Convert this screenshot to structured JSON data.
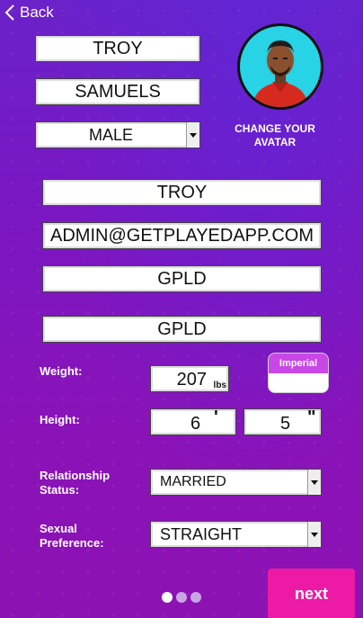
{
  "nav": {
    "back_label": "Back"
  },
  "profile": {
    "first_name": "TROY",
    "last_name": "SAMUELS",
    "gender": "MALE",
    "change_avatar_label": "CHANGE YOUR AVATAR",
    "username": "TROY",
    "email": "ADMIN@GETPLAYEDAPP.COM",
    "field_3": "GPLD",
    "field_4": "GPLD"
  },
  "weight": {
    "label": "Weight:",
    "value": "207",
    "unit": "lbs"
  },
  "units": {
    "selected": "Imperial",
    "other": ""
  },
  "height": {
    "label": "Height:",
    "feet": "6",
    "feet_mark": "'",
    "inches": "5",
    "inches_mark": "\""
  },
  "relationship": {
    "label_line1": "Relationship",
    "label_line2": "Status:",
    "value": "MARRIED"
  },
  "sexual_preference": {
    "label_line1": "Sexual",
    "label_line2": "Preference:",
    "value": "STRAIGHT"
  },
  "pagination": {
    "current": 1,
    "total": 3
  },
  "actions": {
    "next_label": "next"
  },
  "colors": {
    "accent": "#ec1aa4",
    "unit_tab": "#c947e6",
    "avatar_bg": "#27d3e4"
  }
}
